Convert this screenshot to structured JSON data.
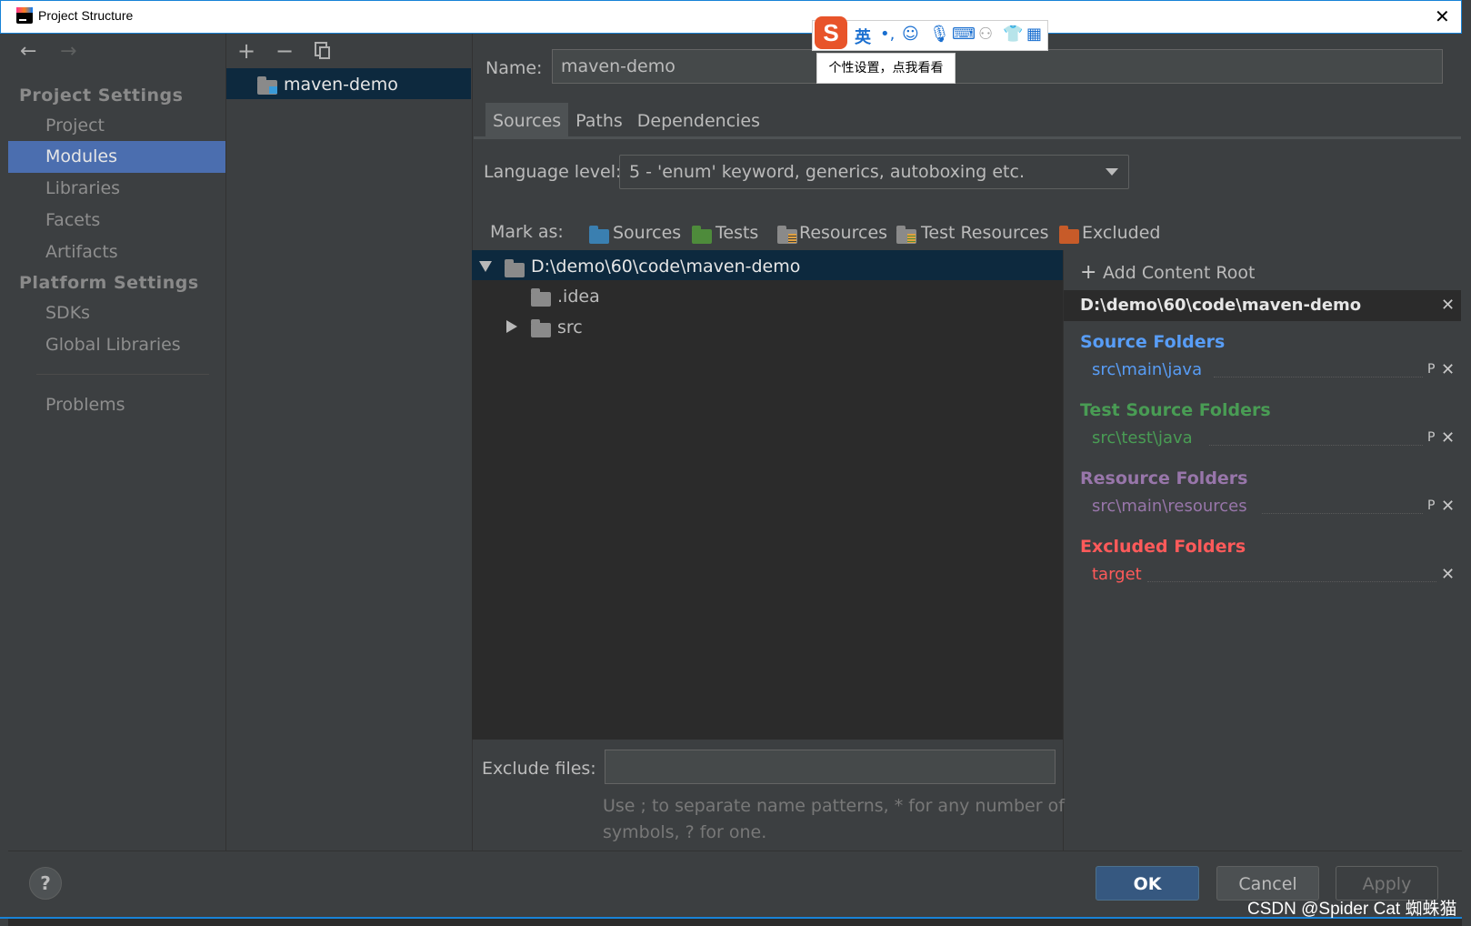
{
  "window": {
    "title": "Project Structure"
  },
  "sidebar": {
    "section_project": "Project Settings",
    "project_items": [
      "Project",
      "Modules",
      "Libraries",
      "Facets",
      "Artifacts"
    ],
    "section_platform": "Platform Settings",
    "platform_items": [
      "SDKs",
      "Global Libraries"
    ],
    "problems": "Problems",
    "selected": "Modules"
  },
  "modules": {
    "items": [
      "maven-demo"
    ],
    "selected": "maven-demo"
  },
  "main": {
    "name_label": "Name:",
    "name_value": "maven-demo",
    "tabs": [
      "Sources",
      "Paths",
      "Dependencies"
    ],
    "active_tab": "Sources",
    "language_level_label": "Language level:",
    "language_level_value": "5 - 'enum' keyword, generics, autoboxing etc.",
    "mark_as_label": "Mark as:",
    "mark_as": [
      {
        "label": "Sources",
        "color": "#3a7fb0"
      },
      {
        "label": "Tests",
        "color": "#4e8b3b"
      },
      {
        "label": "Resources",
        "color": "#8a8a8a"
      },
      {
        "label": "Test Resources",
        "color": "#8a8a8a"
      },
      {
        "label": "Excluded",
        "color": "#c75b29"
      }
    ],
    "tree": [
      {
        "label": "D:\\demo\\60\\code\\maven-demo",
        "expanded": true,
        "selected": true
      },
      {
        "label": ".idea"
      },
      {
        "label": "src",
        "expandable": true
      }
    ],
    "exclude_label": "Exclude files:",
    "exclude_value": "",
    "exclude_hint_1": "Use ; to separate name patterns, * for any number of",
    "exclude_hint_2": "symbols, ? for one."
  },
  "content_root": {
    "add_label": "Add Content Root",
    "root_path": "D:\\demo\\60\\code\\maven-demo",
    "source_title": "Source Folders",
    "source_path": "src\\main\\java",
    "source_color": "#589df6",
    "test_title": "Test Source Folders",
    "test_path": "src\\test\\java",
    "test_color": "#499c54",
    "resource_title": "Resource Folders",
    "resource_path": "src\\main\\resources",
    "resource_color": "#9876aa",
    "excluded_title": "Excluded Folders",
    "excluded_path": "target",
    "excluded_color": "#ff5a5a"
  },
  "buttons": {
    "ok": "OK",
    "cancel": "Cancel",
    "apply": "Apply",
    "help": "?"
  },
  "ime": {
    "mode": "英",
    "tooltip": "个性设置，点我看看"
  },
  "watermark": "CSDN @Spider Cat 蜘蛛猫"
}
